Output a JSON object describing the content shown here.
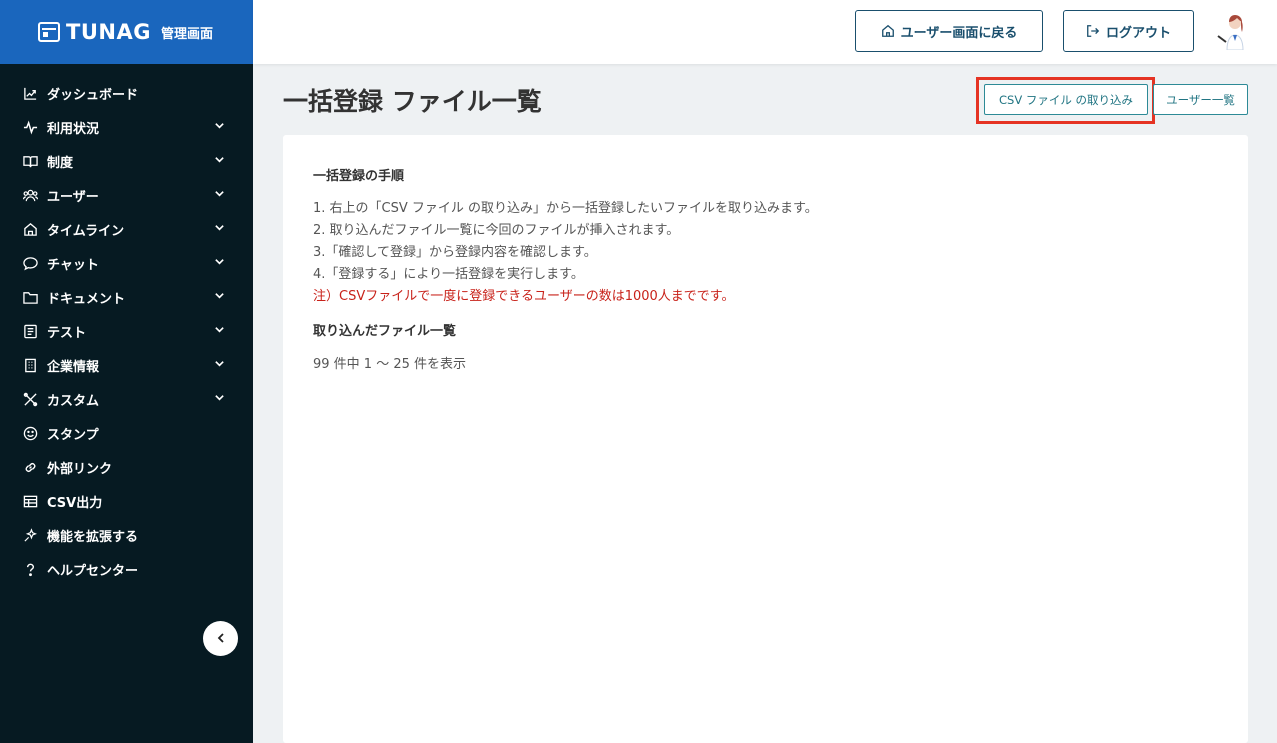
{
  "brand": {
    "name": "TUNAG",
    "sub": "管理画面",
    "color": "#1a66bd"
  },
  "sidebar": {
    "items": [
      {
        "label": "ダッシュボード",
        "icon": "chart-line-icon",
        "expandable": false
      },
      {
        "label": "利用状況",
        "icon": "activity-icon",
        "expandable": true
      },
      {
        "label": "制度",
        "icon": "book-icon",
        "expandable": true
      },
      {
        "label": "ユーザー",
        "icon": "users-icon",
        "expandable": true
      },
      {
        "label": "タイムライン",
        "icon": "home-icon",
        "expandable": true
      },
      {
        "label": "チャット",
        "icon": "chat-bubble-icon",
        "expandable": true
      },
      {
        "label": "ドキュメント",
        "icon": "folder-icon",
        "expandable": true
      },
      {
        "label": "テスト",
        "icon": "checklist-icon",
        "expandable": true
      },
      {
        "label": "企業情報",
        "icon": "building-icon",
        "expandable": true
      },
      {
        "label": "カスタム",
        "icon": "tools-icon",
        "expandable": true
      },
      {
        "label": "スタンプ",
        "icon": "smile-icon",
        "expandable": false
      },
      {
        "label": "外部リンク",
        "icon": "link-icon",
        "expandable": false
      },
      {
        "label": "CSV出力",
        "icon": "table-icon",
        "expandable": false
      },
      {
        "label": "機能を拡張する",
        "icon": "sparkle-icon",
        "expandable": false
      },
      {
        "label": "ヘルプセンター",
        "icon": "help-icon",
        "expandable": false
      }
    ]
  },
  "header": {
    "home_label": "ユーザー画面に戻る",
    "logout_label": "ログアウト"
  },
  "page": {
    "title": "一括登録 ファイル一覧",
    "csv_import_label": "CSV ファイル の取り込み",
    "user_list_label": "ユーザー一覧",
    "procedure_title": "一括登録の手順",
    "steps": [
      "1. 右上の「CSV ファイル の取り込み」から一括登録したいファイルを取り込みます。",
      "2. 取り込んだファイル一覧に今回のファイルが挿入されます。",
      "3.「確認して登録」から登録内容を確認します。",
      "4.「登録する」により一括登録を実行します。"
    ],
    "note": "注）CSVファイルで一度に登録できるユーザーの数は1000人までです。",
    "imported_title": "取り込んだファイル一覧",
    "count_text": "99 件中 1 〜 25 件を表示"
  },
  "colors": {
    "accent": "#217583",
    "note": "#c8221a",
    "highlight": "#e53323",
    "sidebar_bg": "#061a22"
  }
}
